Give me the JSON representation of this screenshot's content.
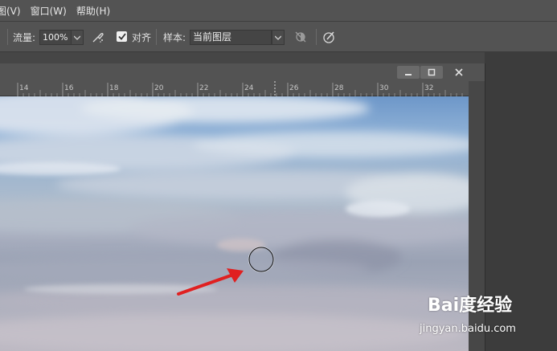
{
  "menu": {
    "items": [
      "图(V)",
      "窗口(W)",
      "帮助(H)"
    ]
  },
  "options": {
    "flow_label": "流量:",
    "flow_value": "100%",
    "align_label": "对齐",
    "align_checked": true,
    "sample_label": "样本:",
    "sample_value": "当前图层",
    "icons": [
      "airbrush-icon",
      "ignore-adjustment-layers-icon",
      "pressure-size-icon"
    ]
  },
  "document": {
    "window_buttons": [
      "minimize",
      "maximize",
      "close"
    ],
    "ruler_ticks": [
      "14",
      "16",
      "18",
      "20",
      "22",
      "24",
      "26",
      "28",
      "30",
      "32"
    ]
  },
  "watermark": {
    "logo_text": "Bai度经验",
    "url": "jingyan.baidu.com"
  },
  "colors": {
    "ui_dark": "#535353",
    "arrow_red": "#e02020",
    "sky_blue": "#6d97c9"
  }
}
